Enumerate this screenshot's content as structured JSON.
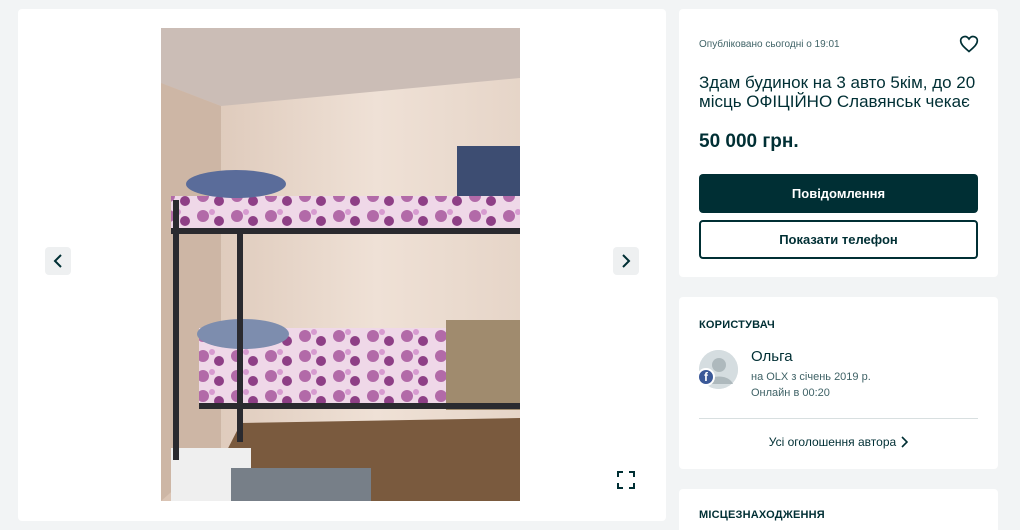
{
  "listing": {
    "posted": "Опубліковано сьогодні о 19:01",
    "title": "Здам будинок на 3 авто 5кім, до 20 місць ОФІЦІЙНО Славянськ чекає",
    "price": "50 000 грн.",
    "message_button": "Повідомлення",
    "phone_button": "Показати телефон"
  },
  "user": {
    "section_title": "КОРИСТУВАЧ",
    "name": "Ольга",
    "since": "на OLX з січень 2019 р.",
    "online": "Онлайн в 00:20",
    "all_ads_link": "Усі оголошення автора",
    "social_badge": "f"
  },
  "location": {
    "section_title": "МІСЦЕЗНАХОДЖЕННЯ"
  },
  "icons": {
    "prev": "chevron-left-icon",
    "next": "chevron-right-icon",
    "expand": "expand-icon",
    "favorite": "heart-icon",
    "link_arrow": "chevron-right-icon"
  },
  "colors": {
    "primary": "#002f34",
    "background": "#f2f4f5",
    "secondary_text": "#406367",
    "facebook": "#3b5998"
  }
}
